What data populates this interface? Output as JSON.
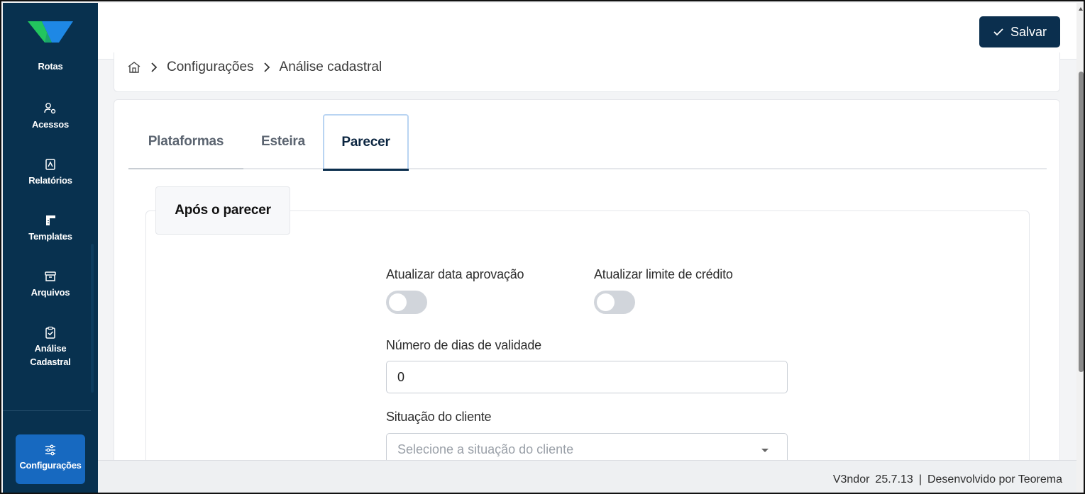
{
  "brand": {
    "logo_icon": "v3ndor-logo-icon",
    "colors": {
      "primary": "#08314f",
      "accent": "#1769c0",
      "logo_green": "#22c55e",
      "logo_blue": "#1e88e5"
    }
  },
  "sidebar": {
    "items": [
      {
        "label": "Rotas",
        "icon": "route-icon"
      },
      {
        "label": "Acessos",
        "icon": "users-gear-icon"
      },
      {
        "label": "Relatórios",
        "icon": "report-icon"
      },
      {
        "label": "Templates",
        "icon": "template-icon"
      },
      {
        "label": "Arquivos",
        "icon": "archive-icon"
      },
      {
        "label_line1": "Análise",
        "label_line2": "Cadastral",
        "icon": "clipboard-check-icon"
      }
    ],
    "active": {
      "label": "Configurações",
      "icon": "sliders-icon"
    }
  },
  "toolbar": {
    "save_label": "Salvar",
    "save_icon": "check-icon"
  },
  "breadcrumb": {
    "home_icon": "home-icon",
    "level1": "Configurações",
    "level2": "Análise cadastral"
  },
  "tabs": [
    {
      "label": "Plataformas",
      "active": false
    },
    {
      "label": "Esteira",
      "active": false
    },
    {
      "label": "Parecer",
      "active": true
    }
  ],
  "form": {
    "section_title": "Após o parecer",
    "toggle_approval_label": "Atualizar data aprovação",
    "toggle_approval_on": false,
    "toggle_credit_label": "Atualizar limite de crédito",
    "toggle_credit_on": false,
    "validity_label": "Número de dias de validade",
    "validity_value": "0",
    "client_status_label": "Situação do cliente",
    "client_status_placeholder": "Selecione a situação do cliente"
  },
  "footer": {
    "app": "V3ndor",
    "version": "25.7.13",
    "separator": "|",
    "credit": "Desenvolvido por Teorema"
  }
}
